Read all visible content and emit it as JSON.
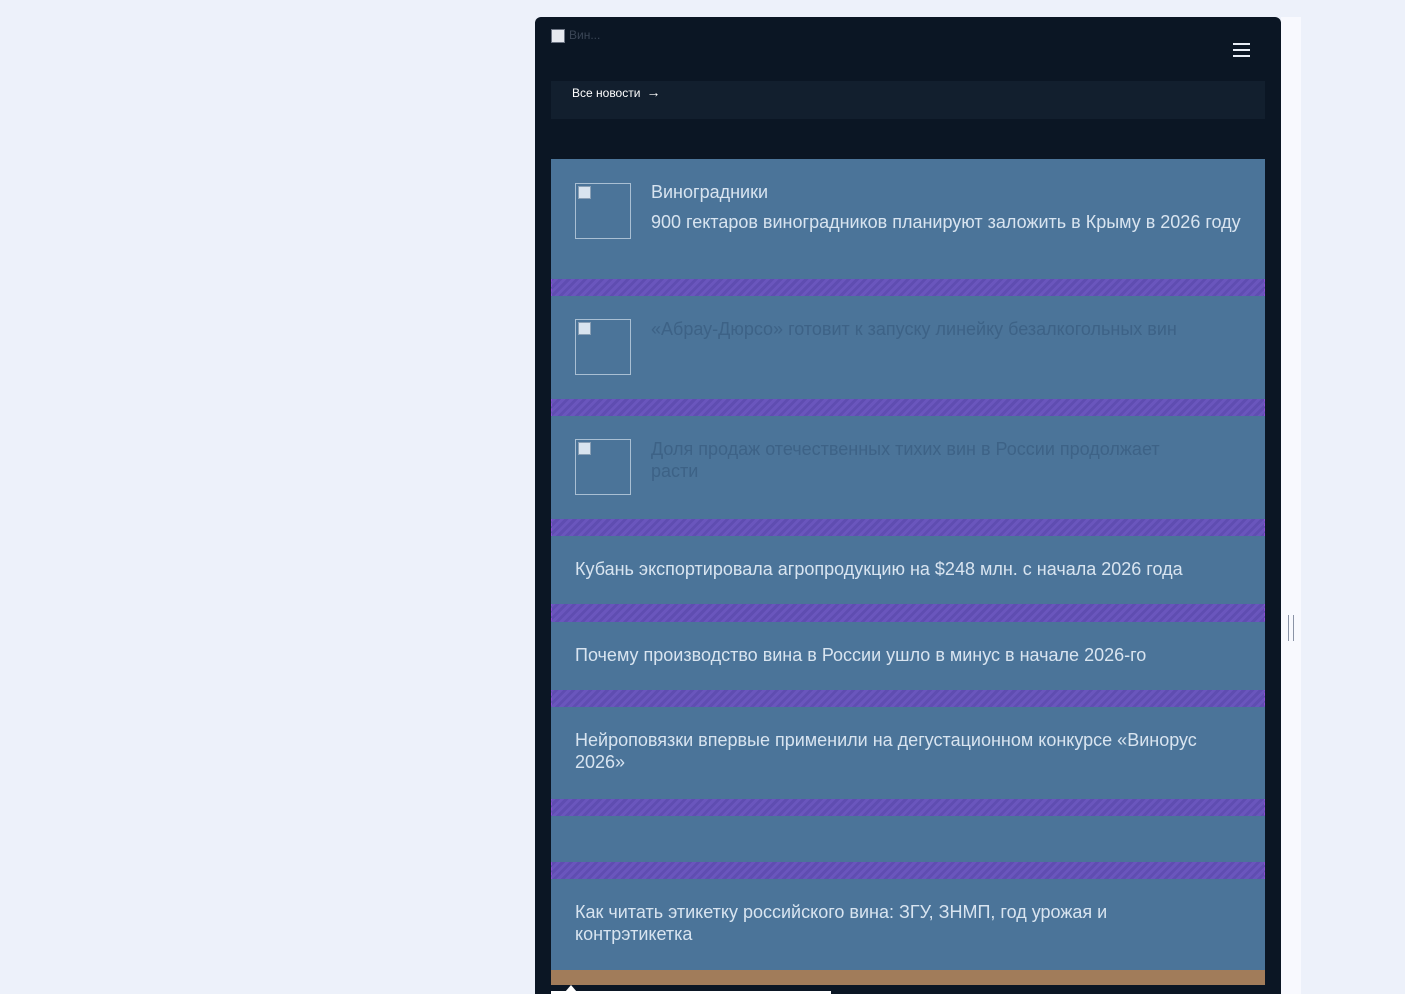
{
  "header": {
    "logo_alt": "Вин...",
    "menu_icon": "hamburger-menu-icon"
  },
  "all_news": {
    "label": "Все новости",
    "arrow": "→"
  },
  "news": [
    {
      "category": "Виноградники",
      "title": "900 гектаров виноградников планируют заложить в Крыму в 2026 году"
    },
    {
      "category": "",
      "title": "«Абрау-Дюрсо» готовит к запуску линейку безалкогольных вин"
    },
    {
      "category": "",
      "title": "Доля продаж отечественных тихих вин в России продолжает расти"
    },
    {
      "category": "",
      "title": "Кубань экспортировала агропродукцию на $248 млн. с начала 2026 года"
    },
    {
      "category": "",
      "title": "Почему производство вина в России ушло в минус в начале 2026-го"
    },
    {
      "category": "",
      "title": "Нейроповязки впервые применили на дегустационном конкурсе «Винорус 2026»"
    },
    {
      "category": "",
      "title": ""
    },
    {
      "category": "",
      "title": "Как читать этикетку российского вина: ЗГУ, ЗНМП, год урожая и контрэтикетка"
    }
  ],
  "colors": {
    "page_bg": "#edf1fa",
    "phone_bg": "#0b1624",
    "news_item_bg": "#4b7499",
    "gap_highlight": "#5f4db1",
    "bottom_bar": "#a17c5a"
  }
}
